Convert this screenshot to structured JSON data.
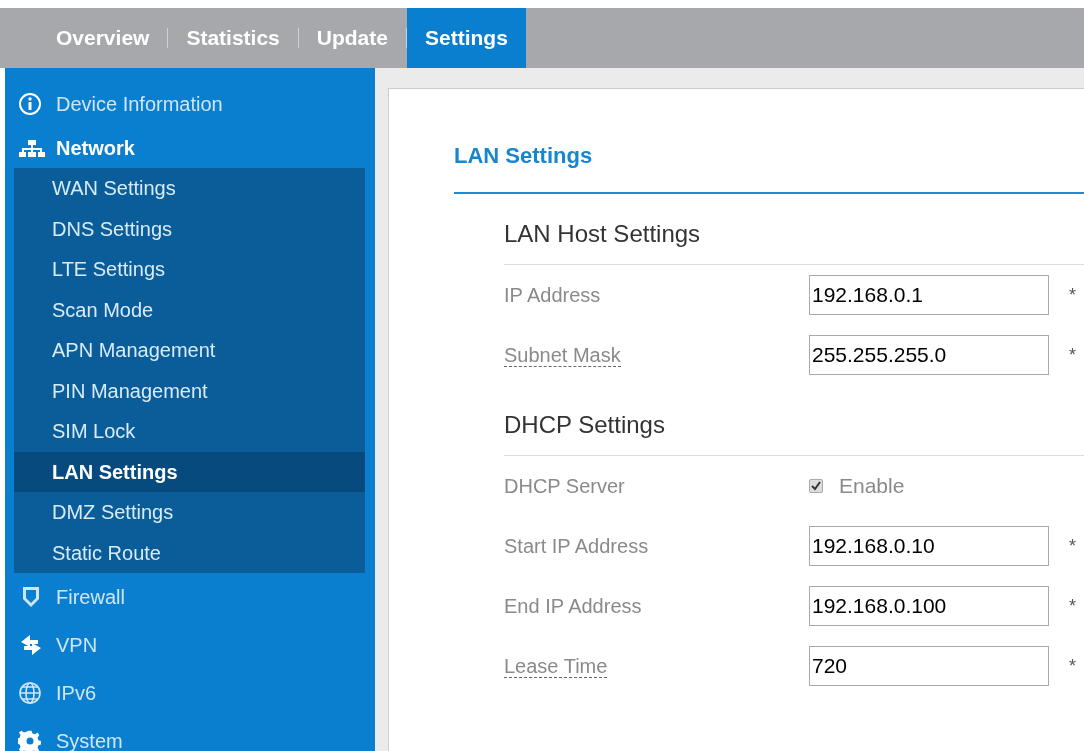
{
  "tabs": [
    {
      "label": "Overview",
      "selected": false
    },
    {
      "label": "Statistics",
      "selected": false
    },
    {
      "label": "Update",
      "selected": false
    },
    {
      "label": "Settings",
      "selected": true
    }
  ],
  "sidebar": {
    "items": [
      {
        "label": "Device Information",
        "expanded": false
      },
      {
        "label": "Network",
        "expanded": true,
        "children": [
          {
            "label": "WAN Settings",
            "selected": false
          },
          {
            "label": "DNS Settings",
            "selected": false
          },
          {
            "label": "LTE Settings",
            "selected": false
          },
          {
            "label": "Scan Mode",
            "selected": false
          },
          {
            "label": "APN Management",
            "selected": false
          },
          {
            "label": "PIN Management",
            "selected": false
          },
          {
            "label": "SIM Lock",
            "selected": false
          },
          {
            "label": "LAN Settings",
            "selected": true
          },
          {
            "label": "DMZ Settings",
            "selected": false
          },
          {
            "label": "Static Route",
            "selected": false
          }
        ]
      },
      {
        "label": "Firewall",
        "expanded": false
      },
      {
        "label": "VPN",
        "expanded": false
      },
      {
        "label": "IPv6",
        "expanded": false
      },
      {
        "label": "System",
        "expanded": false
      }
    ]
  },
  "page_title": "LAN Settings",
  "sections": [
    {
      "title": "LAN Host Settings",
      "fields": [
        {
          "kind": "text",
          "label": "IP Address",
          "underlined": false,
          "value": "192.168.0.1",
          "required": "*"
        },
        {
          "kind": "text",
          "label": "Subnet Mask",
          "underlined": true,
          "value": "255.255.255.0",
          "required": "*"
        }
      ]
    },
    {
      "title": "DHCP Settings",
      "fields": [
        {
          "kind": "checkbox",
          "label": "DHCP Server",
          "underlined": false,
          "option": "Enable",
          "checked": true
        },
        {
          "kind": "text",
          "label": "Start IP Address",
          "underlined": false,
          "value": "192.168.0.10",
          "required": "*"
        },
        {
          "kind": "text",
          "label": "End IP Address",
          "underlined": false,
          "value": "192.168.0.100",
          "required": "*"
        },
        {
          "kind": "text",
          "label": "Lease Time",
          "underlined": true,
          "value": "720",
          "required": "*"
        }
      ]
    }
  ]
}
